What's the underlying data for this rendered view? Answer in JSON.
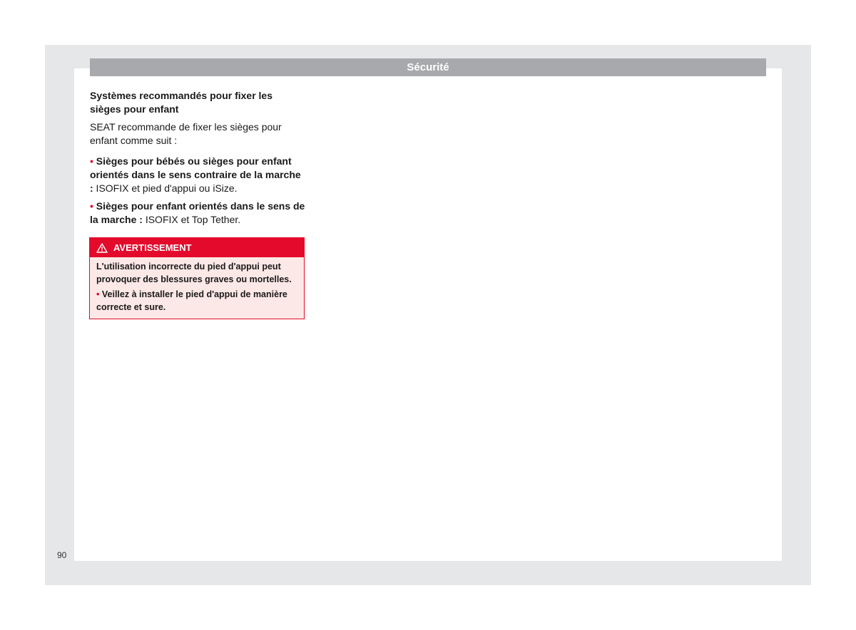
{
  "header": {
    "title": "Sécurité"
  },
  "section": {
    "title": "Systèmes recommandés pour fixer les sièges pour enfant",
    "intro": "SEAT recommande de fixer les sièges pour enfant comme suit :",
    "items": [
      {
        "bold": "Sièges pour bébés ou sièges pour enfant orientés dans le sens contraire de la mar­che :",
        "text": " ISOFIX et pied d'appui ou iSize."
      },
      {
        "bold": "Sièges pour enfant orientés dans le sens de la marche :",
        "text": " ISOFIX et Top Tether."
      }
    ]
  },
  "warning": {
    "icon": "warning-triangle-icon",
    "title": "AVERTISSEMENT",
    "text": "L'utilisation incorrecte du pied d'appui peut provoquer des blessures graves ou mortelles.",
    "items": [
      "Veillez à installer le pied d'appui de maniè­re correcte et sure."
    ]
  },
  "footer": {
    "page_number": "90"
  },
  "colors": {
    "accent": "#e30a2c",
    "header_bar": "#a7a9ac",
    "frame": "#e6e7e8",
    "warning_bg": "#fce8e6"
  }
}
